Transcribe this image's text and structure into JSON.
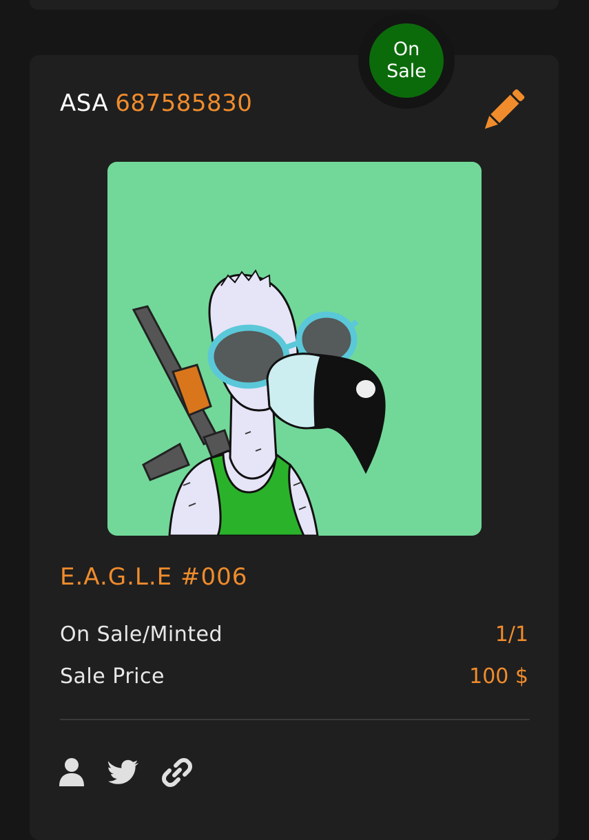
{
  "badge": {
    "line1": "On",
    "line2": "Sale",
    "color": "#0b6b0b"
  },
  "asset": {
    "label": "ASA",
    "id": "687585830"
  },
  "nft": {
    "title": "E.A.G.L.E #006"
  },
  "stats": [
    {
      "key": "On Sale/Minted",
      "value": "1/1"
    },
    {
      "key": "Sale Price",
      "value": "100 $"
    }
  ],
  "icons": {
    "edit": "pencil-icon",
    "social": [
      "user-icon",
      "twitter-icon",
      "link-icon"
    ]
  },
  "colors": {
    "accent": "#f08c2c",
    "card": "#1f1f1f",
    "background": "#161616",
    "art_bg": "#72d899"
  }
}
